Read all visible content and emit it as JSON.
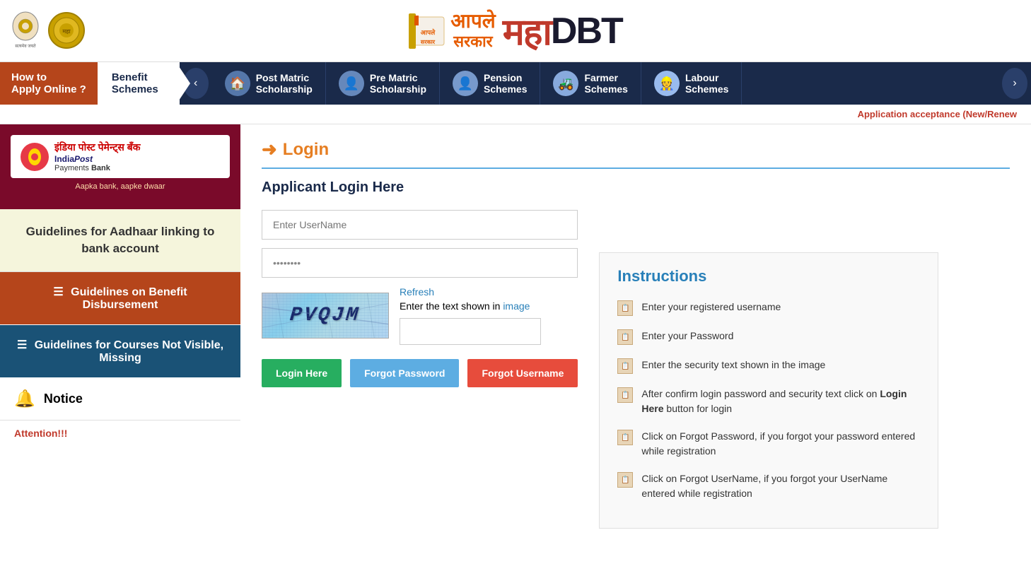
{
  "header": {
    "brand_hindi_line1": "आपले",
    "brand_hindi_line2": "सरकार",
    "brand_maha": "महा",
    "brand_dbt": "DBT",
    "bank_name": "India Post Payments Bank",
    "bank_hindi": "इंडिया पोस्ट पेमेन्ट्स बँक",
    "bank_tagline": "Aapka bank, aapke dwaar"
  },
  "navbar": {
    "how_to_line1": "How to",
    "how_to_line2": "Apply Online ?",
    "benefit_schemes_line1": "Benefit",
    "benefit_schemes_line2": "Schemes",
    "items": [
      {
        "label": "Post Matric Scholarship",
        "icon": "🏠"
      },
      {
        "label": "Pre Matric Scholarship",
        "icon": "👤"
      },
      {
        "label": "Pension Schemes",
        "icon": "👤"
      },
      {
        "label": "Farmer Schemes",
        "icon": "🚜"
      },
      {
        "label": "Labour Schemes",
        "icon": "👷"
      }
    ]
  },
  "announcement": {
    "text": "Application acceptance (New/Renew"
  },
  "sidebar": {
    "aadhaar_guideline": "Guidelines for Aadhaar linking to bank account",
    "benefit_disbursement": "Guidelines on Benefit Disbursement",
    "courses_not_visible": "Guidelines for Courses Not Visible, Missing",
    "notice_label": "Notice",
    "attention_text": "Attention!!!"
  },
  "login": {
    "title": "Login",
    "subtitle": "Applicant Login Here",
    "username_placeholder": "Enter UserName",
    "password_placeholder": "••••••••",
    "captcha_text": "PVQJM",
    "refresh_label": "Refresh",
    "captcha_hint": "Enter the text shown in image",
    "captcha_hint_colored": "image",
    "captcha_input_placeholder": "",
    "btn_login": "Login Here",
    "btn_forgot_password": "Forgot Password",
    "btn_forgot_username": "Forgot Username"
  },
  "instructions": {
    "title": "Instructions",
    "items": [
      {
        "text": "Enter your registered username"
      },
      {
        "text": "Enter your Password"
      },
      {
        "text": "Enter the security text shown in the image"
      },
      {
        "text": "After confirm login password and security text click on <strong>Login Here</strong> button for login"
      },
      {
        "text": "Click on Forgot Password, if you forgot your password entered while registration"
      },
      {
        "text": "Click on Forgot UserName, if you forgot your UserName entered while registration"
      }
    ]
  }
}
